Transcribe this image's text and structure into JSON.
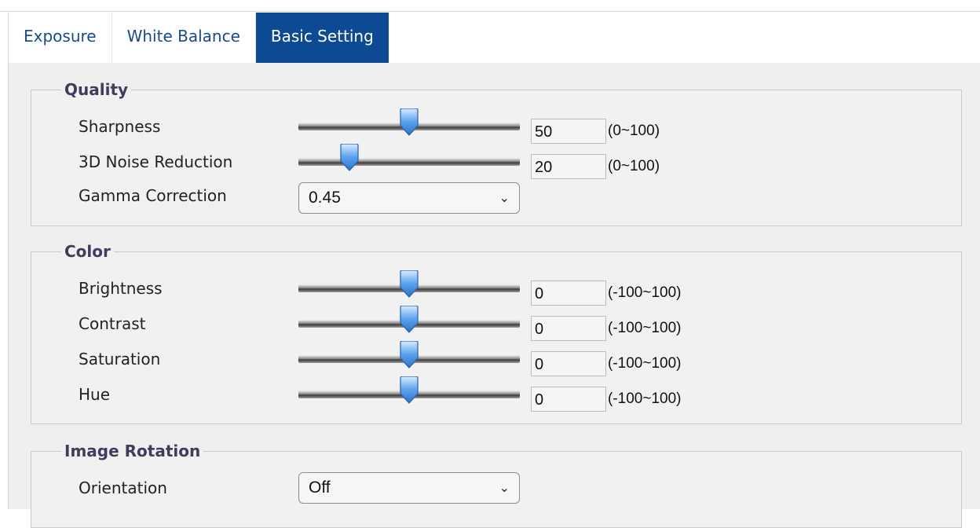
{
  "tabs": [
    {
      "label": "Exposure",
      "active": false
    },
    {
      "label": "White Balance",
      "active": false
    },
    {
      "label": "Basic Setting",
      "active": true
    }
  ],
  "quality": {
    "legend": "Quality",
    "sharpness": {
      "label": "Sharpness",
      "value": "50",
      "range": "(0~100)",
      "min": 0,
      "max": 100
    },
    "noise_reduction": {
      "label": "3D Noise Reduction",
      "value": "20",
      "range": "(0~100)",
      "min": 0,
      "max": 100
    },
    "gamma": {
      "label": "Gamma Correction",
      "selected": "0.45"
    }
  },
  "color": {
    "legend": "Color",
    "brightness": {
      "label": "Brightness",
      "value": "0",
      "range": "(-100~100)",
      "min": -100,
      "max": 100
    },
    "contrast": {
      "label": "Contrast",
      "value": "0",
      "range": "(-100~100)",
      "min": -100,
      "max": 100
    },
    "saturation": {
      "label": "Saturation",
      "value": "0",
      "range": "(-100~100)",
      "min": -100,
      "max": 100
    },
    "hue": {
      "label": "Hue",
      "value": "0",
      "range": "(-100~100)",
      "min": -100,
      "max": 100
    }
  },
  "rotation": {
    "legend": "Image Rotation",
    "orientation": {
      "label": "Orientation",
      "selected": "Off"
    }
  },
  "colors": {
    "active_tab": "#0d4a94",
    "tab_text": "#1a4a8c",
    "legend_text": "#3d3d5c"
  },
  "icons": {
    "slider_thumb": "slider-thumb-icon",
    "dropdown": "chevron-down-icon"
  }
}
